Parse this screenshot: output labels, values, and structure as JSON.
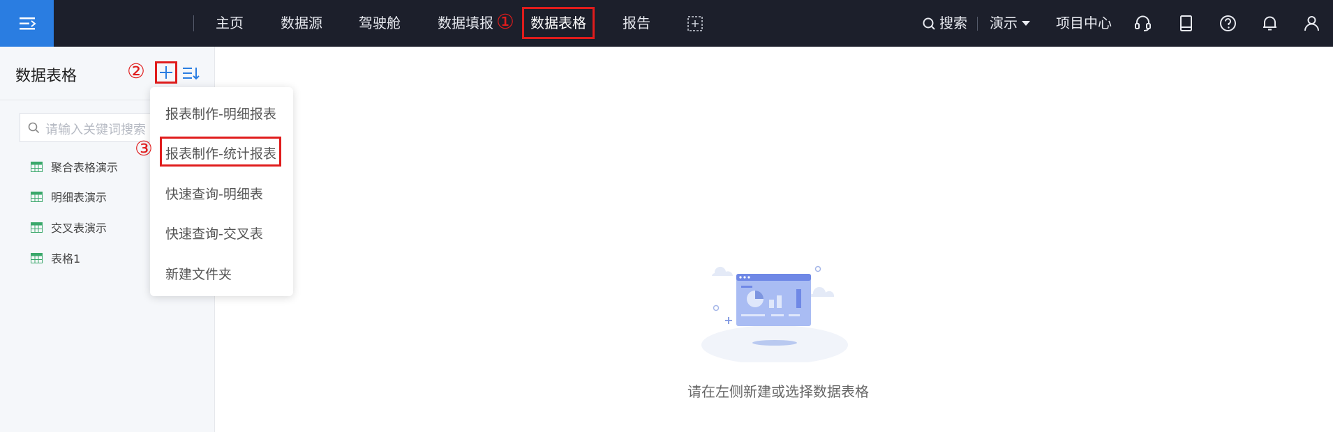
{
  "topnav": {
    "items": [
      "主页",
      "数据源",
      "驾驶舱",
      "数据填报",
      "数据表格",
      "报告"
    ],
    "active": "数据表格",
    "annotation_1": "①",
    "search_label": "搜索",
    "demo_label": "演示",
    "project_center": "项目中心"
  },
  "sidebar": {
    "title": "数据表格",
    "annotation_2": "②",
    "search_placeholder": "请输入关键词搜索",
    "items": [
      "聚合表格演示",
      "明细表演示",
      "交叉表演示",
      "表格1"
    ]
  },
  "dropdown": {
    "annotation_3": "③",
    "items": [
      "报表制作-明细报表",
      "报表制作-统计报表",
      "快速查询-明细表",
      "快速查询-交叉表",
      "新建文件夹"
    ]
  },
  "main": {
    "empty_text": "请在左侧新建或选择数据表格"
  },
  "colors": {
    "topbar": "#1c1f2b",
    "accent": "#2a7de1",
    "annotation": "#e01c1c",
    "table_icon": "#3aa86b"
  }
}
